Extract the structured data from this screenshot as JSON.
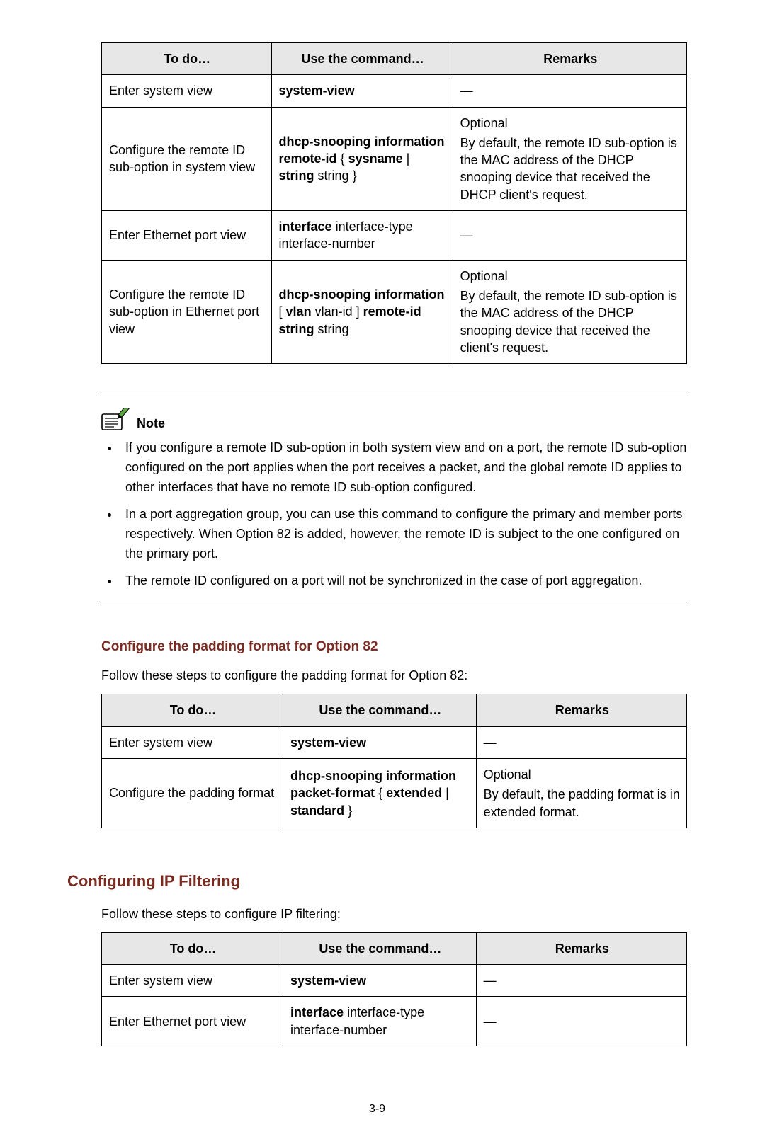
{
  "table1": {
    "headers": {
      "todo": "To do…",
      "cmd": "Use the command…",
      "rmk": "Remarks"
    },
    "r1_todo": "Enter system view",
    "r1_cmd_b": "system-view",
    "r1_rmk": "—",
    "r2_todo": "Configure the remote ID sub-option in system view",
    "r2_cmd_b1": "dhcp-snooping information remote-id",
    "r2_cmd_t1": " { ",
    "r2_cmd_b2": "sysname",
    "r2_cmd_t2": " | ",
    "r2_cmd_b3": "string",
    "r2_cmd_t3": " string }",
    "r2_rmk_l1": "Optional",
    "r2_rmk_l2": "By default, the remote ID sub-option is the MAC address of the DHCP snooping device that received the DHCP client's request.",
    "r3_todo": "Enter Ethernet port view",
    "r3_cmd_b": "interface",
    "r3_cmd_t": " interface-type interface-number",
    "r3_rmk": "—",
    "r4_todo": "Configure the remote ID sub-option in Ethernet port view",
    "r4_cmd_b1": "dhcp-snooping information",
    "r4_cmd_t1": " [ ",
    "r4_cmd_b2": "vlan",
    "r4_cmd_t2": " vlan-id ] ",
    "r4_cmd_b3": "remote-id string",
    "r4_cmd_t3": " string",
    "r4_rmk_l1": "Optional",
    "r4_rmk_l2": "By default, the remote ID sub-option is the MAC address of the DHCP snooping device that received the client's request."
  },
  "note": {
    "label": "Note",
    "li1": "If you configure a remote ID sub-option in both system view and on a port, the remote ID sub-option configured on the port applies when the port receives a packet, and the global remote ID applies to other interfaces that have no remote ID sub-option configured.",
    "li2": "In a port aggregation group, you can use this command to configure the primary and member ports respectively. When Option 82 is added, however, the remote ID is subject to the one configured on the primary port.",
    "li3": "The remote ID configured on a port will not be synchronized in the case of port aggregation."
  },
  "section2": {
    "heading": "Configure the padding format for Option 82",
    "intro": "Follow these steps to configure the padding format for Option 82:",
    "headers": {
      "todo": "To do…",
      "cmd": "Use the command…",
      "rmk": "Remarks"
    },
    "r1_todo": "Enter system view",
    "r1_cmd_b": "system-view",
    "r1_rmk": "—",
    "r2_todo": "Configure the padding format",
    "r2_cmd_b1": "dhcp-snooping information packet-format",
    "r2_cmd_t1": " { ",
    "r2_cmd_b2": "extended",
    "r2_cmd_t2": " | ",
    "r2_cmd_b3": "standard",
    "r2_cmd_t3": " }",
    "r2_rmk_l1": "Optional",
    "r2_rmk_l2": "By default, the padding format is in extended format."
  },
  "section3": {
    "heading": "Configuring IP Filtering",
    "intro": "Follow these steps to configure IP filtering:",
    "headers": {
      "todo": "To do…",
      "cmd": "Use the command…",
      "rmk": "Remarks"
    },
    "r1_todo": "Enter system view",
    "r1_cmd_b": "system-view",
    "r1_rmk": "—",
    "r2_todo": "Enter Ethernet port view",
    "r2_cmd_b": "interface",
    "r2_cmd_t": " interface-type interface-number",
    "r2_rmk": "—"
  },
  "page_number": "3-9"
}
